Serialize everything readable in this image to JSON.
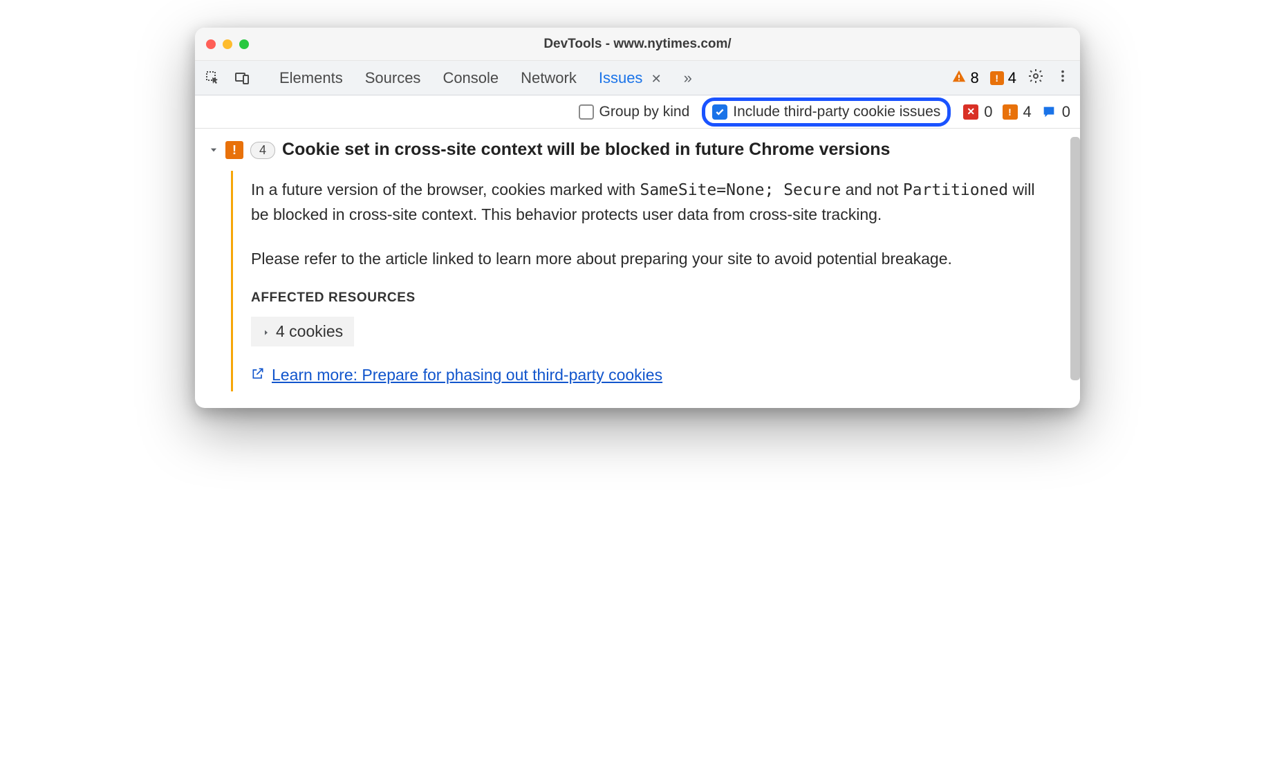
{
  "window": {
    "title": "DevTools - www.nytimes.com/"
  },
  "toolbar": {
    "tabs": [
      "Elements",
      "Sources",
      "Console",
      "Network",
      "Issues"
    ],
    "active_tab": "Issues",
    "warning_triangle_count": "8",
    "warning_square_count": "4"
  },
  "filters": {
    "group_by_kind_label": "Group by kind",
    "group_by_kind_checked": false,
    "include_third_party_label": "Include third-party cookie issues",
    "include_third_party_checked": true,
    "counts": {
      "error": "0",
      "warning": "4",
      "info": "0"
    }
  },
  "issue": {
    "count_badge": "4",
    "title": "Cookie set in cross-site context will be blocked in future Chrome versions",
    "para1_prefix": "In a future version of the browser, cookies marked with ",
    "code1": "SameSite=None; Secure",
    "para1_mid": " and not ",
    "code2": "Partitioned",
    "para1_suffix": " will be blocked in cross-site context. This behavior protects user data from cross-site tracking.",
    "para2": "Please refer to the article linked to learn more about preparing your site to avoid potential breakage.",
    "affected_label": "AFFECTED RESOURCES",
    "affected_cookies": "4 cookies",
    "learn_more": "Learn more: Prepare for phasing out third-party cookies"
  }
}
